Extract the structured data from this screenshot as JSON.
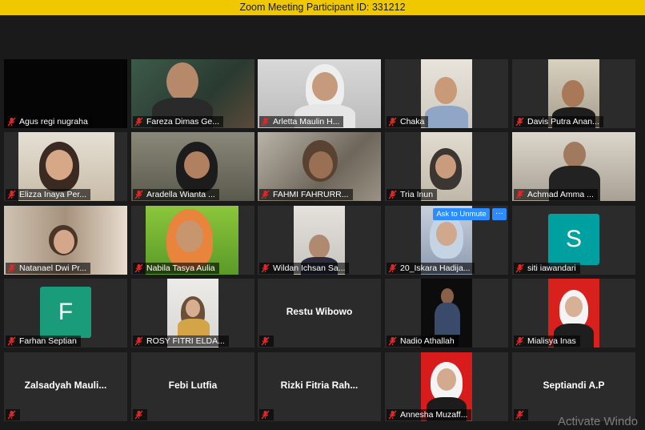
{
  "window": {
    "title": "Zoom Meeting Participant ID: 331212"
  },
  "participants": [
    {
      "name": "Agus regi nugraha"
    },
    {
      "name": "Fareza Dimas Ge..."
    },
    {
      "name": "Arletta Maulin H..."
    },
    {
      "name": "Chaka"
    },
    {
      "name": "Davis Putra Anan..."
    },
    {
      "name": "Elizza Inaya Per..."
    },
    {
      "name": "Aradella Wianta ..."
    },
    {
      "name": "FAHMI FAHRURR..."
    },
    {
      "name": "Tria Inun"
    },
    {
      "name": "Achmad Amma ..."
    },
    {
      "name": "Natanael Dwi Pr..."
    },
    {
      "name": "Nabila Tasya Aulia"
    },
    {
      "name": "Wildan Ichsan Sa..."
    },
    {
      "name": "20_Iskara Hadija..."
    },
    {
      "name": "siti iawandari",
      "avatar_letter": "S",
      "avatar_color": "#00a0a0"
    },
    {
      "name": "Farhan Septian",
      "avatar_letter": "F",
      "avatar_color": "#1a9c7b"
    },
    {
      "name": "ROSY FITRI ELDA..."
    },
    {
      "name": "",
      "display_name": "Restu Wibowo"
    },
    {
      "name": "Nadio Athallah"
    },
    {
      "name": "Mialisya Inas"
    },
    {
      "name": "",
      "display_name": "Zalsadyah  Mauli..."
    },
    {
      "name": "",
      "display_name": "Febi Lutfia"
    },
    {
      "name": "",
      "display_name": "Rizki  Fitria  Rah..."
    },
    {
      "name": "Annesha Muzaff..."
    },
    {
      "name": "",
      "display_name": "Septiandi A.P"
    }
  ],
  "controls": {
    "ask_to_unmute_label": "Ask to Unmute",
    "more_label": "···"
  },
  "watermark": "Activate Windo",
  "colors": {
    "title_bar": "#f0c800",
    "mute_icon": "#e02828",
    "button_blue": "#2d8cff"
  }
}
